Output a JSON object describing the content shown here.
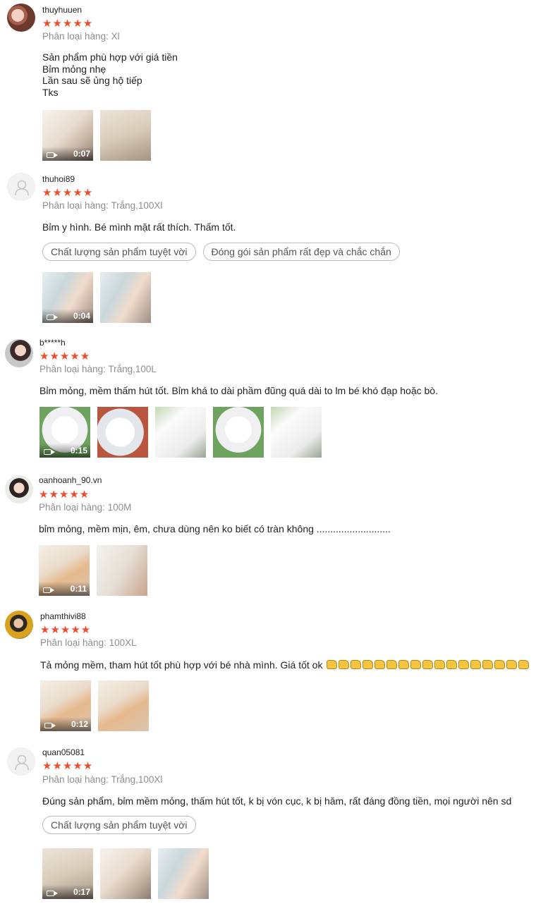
{
  "reviews": [
    {
      "username": "thuyhuuen",
      "stars": "★★★★★",
      "variant": "Phân loại hàng: Xl",
      "content_lines": [
        "Sản phẩm phù hợp với giá tiền",
        "Bỉm mỏng nhẹ",
        "Lần sau sẽ ủng hộ tiếp",
        "Tks"
      ],
      "video_duration": "0:07"
    },
    {
      "username": "thuhoi89",
      "stars": "★★★★★",
      "variant": "Phân loại hàng: Trắng,100Xl",
      "content": "Bỉm y hình.  Bé mình mặt rất thích. Thấm tốt.",
      "tags": [
        "Chất lượng sản phẩm tuyệt vời",
        "Đóng gói sản phẩm rất đẹp và chắc chắn"
      ],
      "video_duration": "0:04"
    },
    {
      "username": "b*****h",
      "stars": "★★★★★",
      "variant": "Phân loại hàng: Trắng,100L",
      "content": "Bỉm mỏng, mềm thấm hút tốt. Bỉm khá to dài phầm đũng quá dài to lm bé khó đạp hoặc bò.",
      "video_duration": "0:15"
    },
    {
      "username": "oanhoanh_90.vn",
      "stars": "★★★★★",
      "variant": "Phân loại hàng: 100M",
      "content": "bỉm mỏng, mềm mịn, êm, chưa dùng nên ko biết có tràn không ...........................",
      "video_duration": "0:11"
    },
    {
      "username": "phamthivi88",
      "stars": "★★★★★",
      "variant": "Phân loại hàng: 100XL",
      "content": "Tả mỏng mềm, tham hút tốt phù hợp với bé nhà mình. Giá tốt ok",
      "emoji_count": 17,
      "video_duration": "0:12"
    },
    {
      "username": "quan05081",
      "stars": "★★★★★",
      "variant": "Phân loại hàng: Trắng,100Xl",
      "content": "Đúng sản phẩm, bỉm mềm mỏng, thấm hút tốt, k bị vón cục, k bị hăm, rất đáng đồng tiền, mọi người nên sd",
      "tags": [
        "Chất lượng sản phẩm tuyệt vời"
      ],
      "video_duration": "0:17"
    }
  ],
  "colors": {
    "star": "#ee4d2d",
    "muted_text": "#8c8c8c",
    "text": "#222222"
  },
  "icons": {
    "video": "video-camera-icon",
    "default_avatar": "user-silhouette-icon",
    "emoji": "thumbs-up-emoji"
  }
}
